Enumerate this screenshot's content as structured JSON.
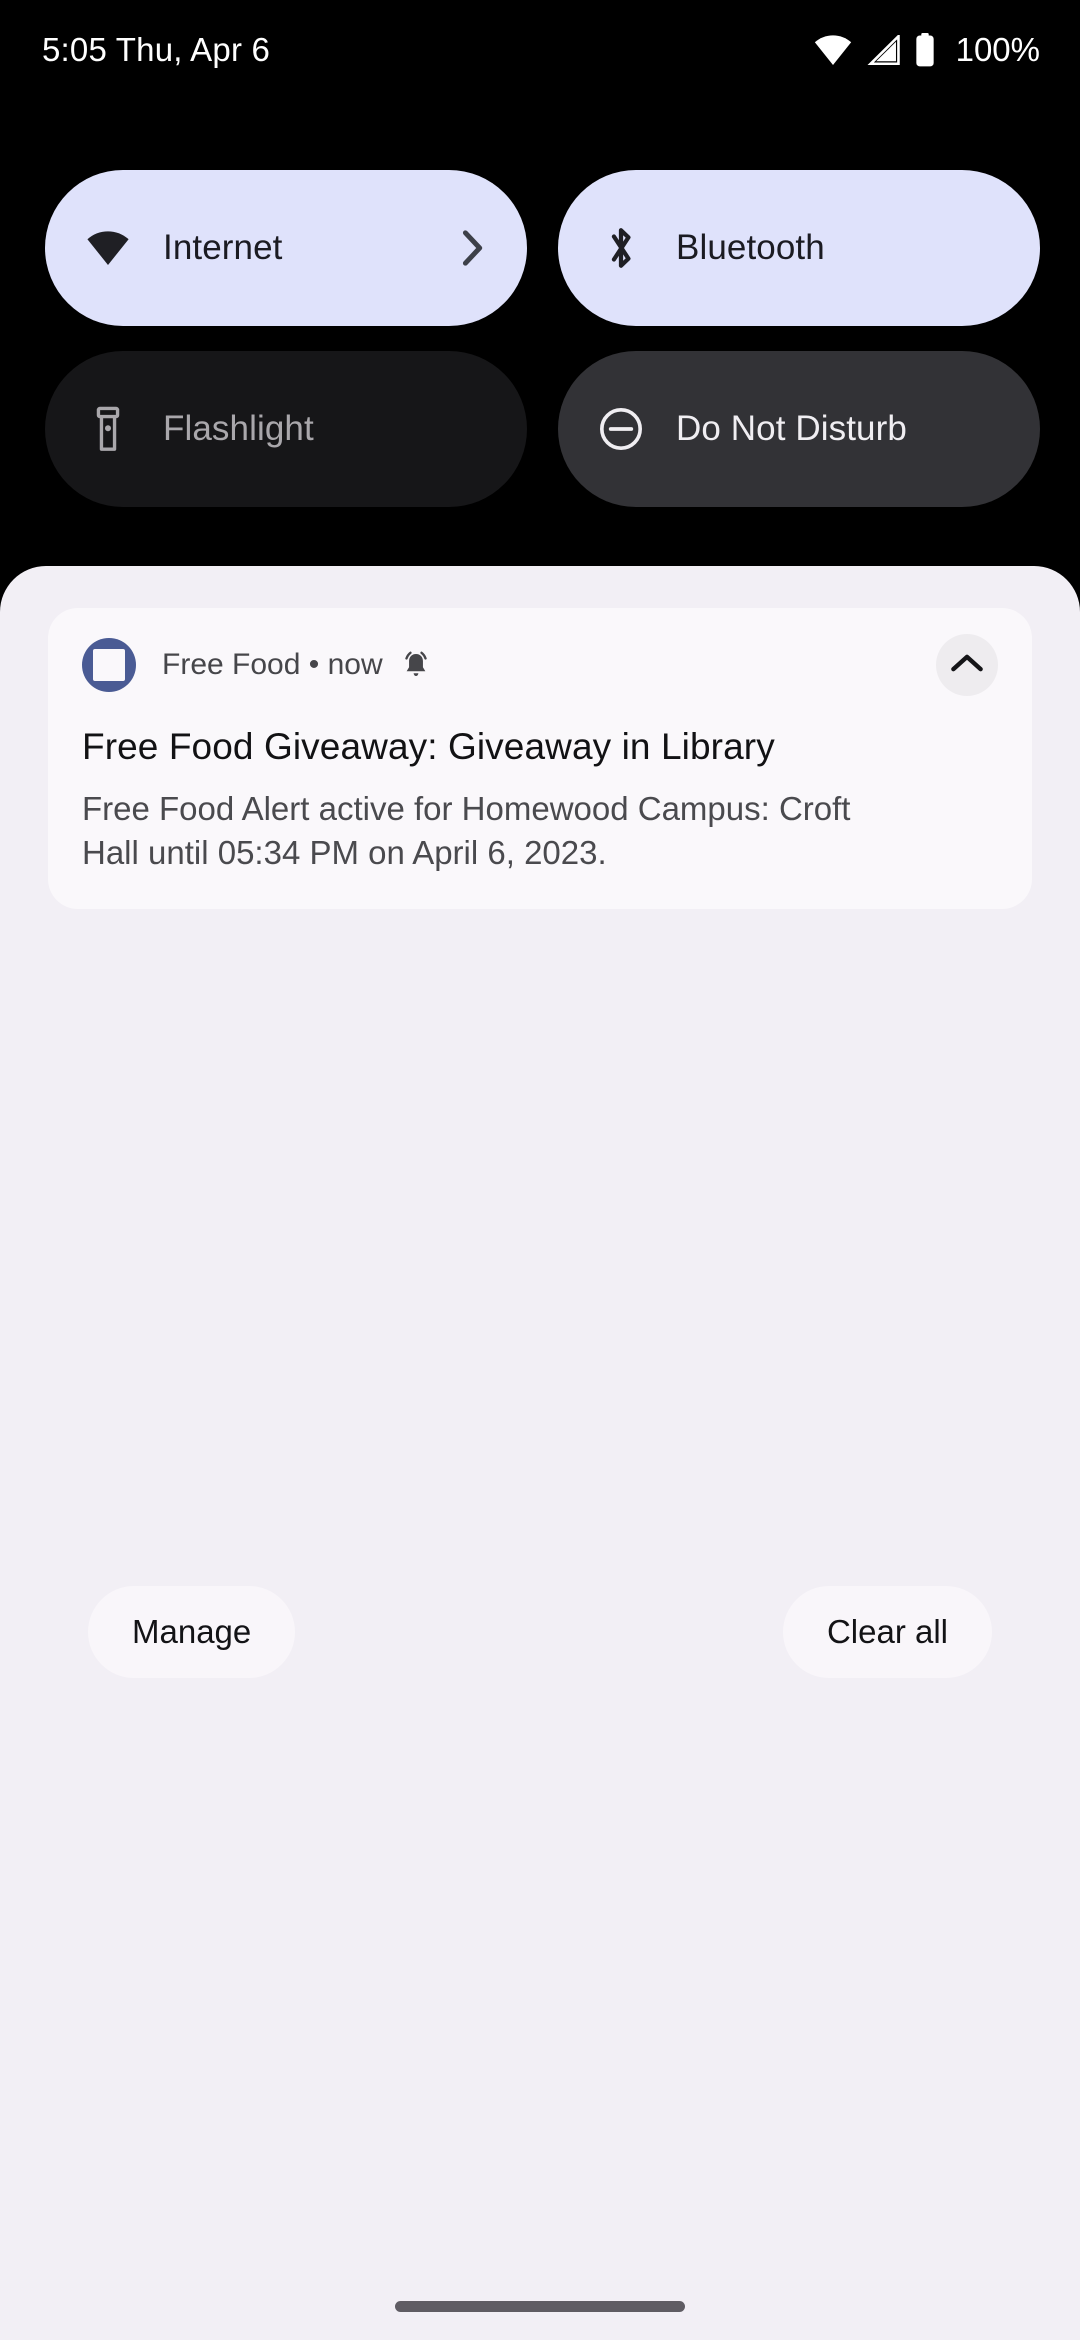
{
  "status_bar": {
    "clock": "5:05 Thu, Apr 6",
    "battery_percent": "100%",
    "icons": [
      "wifi-icon",
      "cellular-signal-icon",
      "battery-icon"
    ]
  },
  "quick_settings": {
    "tiles": [
      {
        "label": "Internet",
        "icon": "wifi-icon",
        "state": "active",
        "has_chevron": true,
        "chevron_icon": "chevron-right-icon"
      },
      {
        "label": "Bluetooth",
        "icon": "bluetooth-icon",
        "state": "active",
        "has_chevron": false,
        "chevron_icon": ""
      },
      {
        "label": "Flashlight",
        "icon": "flashlight-icon",
        "state": "inactive",
        "has_chevron": false,
        "chevron_icon": ""
      },
      {
        "label": "Do Not Disturb",
        "icon": "do-not-disturb-icon",
        "state": "inactive",
        "has_chevron": false,
        "chevron_icon": ""
      }
    ]
  },
  "notification": {
    "app_name_and_time": "Free Food • now",
    "app_icon": "free-food-app-icon",
    "alert_icon": "bell-ringing-icon",
    "collapse_icon": "chevron-up-icon",
    "title": "Free Food Giveaway: Giveaway in Library",
    "body": "Free Food Alert active for Homewood Campus: Croft Hall until 05:34 PM on April 6, 2023."
  },
  "footer": {
    "manage_label": "Manage",
    "clear_all_label": "Clear all"
  },
  "colors": {
    "background": "#000000",
    "tile_active": "#dfe2fb",
    "tile_inactive_dark": "#161618",
    "tile_inactive_gray": "#323236",
    "shade_background": "#f2eff5",
    "card_background": "#faf8fb",
    "app_icon_accent": "#4a5b94",
    "gesture_bar": "#5f5c63"
  }
}
